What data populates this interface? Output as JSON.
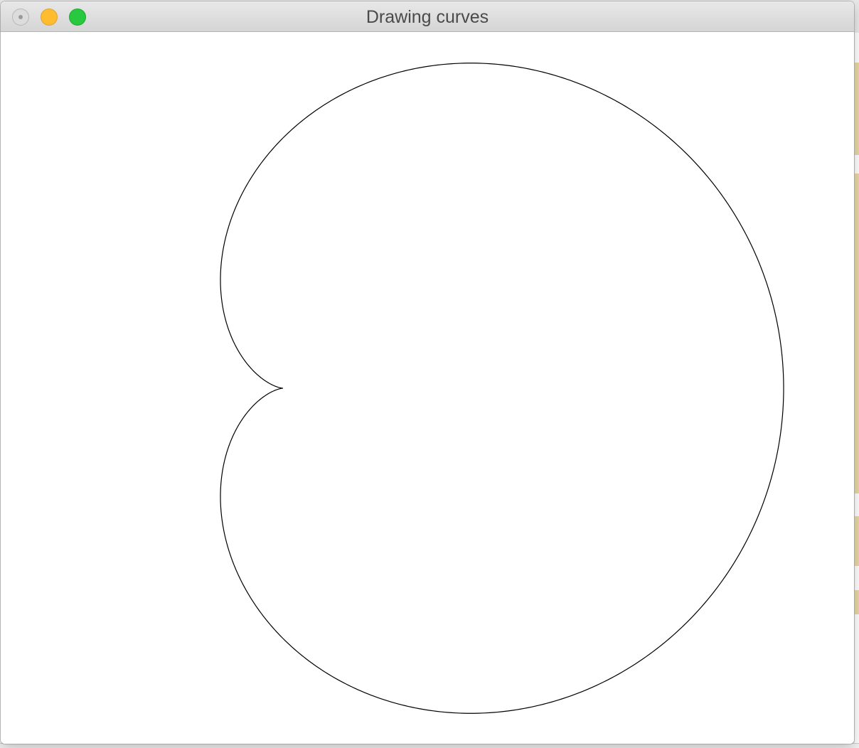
{
  "window": {
    "title": "Drawing curves"
  },
  "controls": {
    "close_icon": "close-icon",
    "minimize_icon": "minimize-icon",
    "zoom_icon": "zoom-icon"
  },
  "curve": {
    "shape": "cardioid",
    "stroke_color": "#000000",
    "background_color": "#ffffff"
  }
}
